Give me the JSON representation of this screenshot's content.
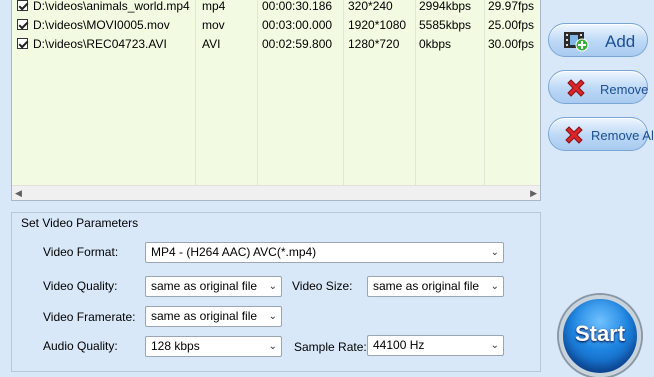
{
  "files": [
    {
      "path": "D:\\videos\\animals_world.mp4",
      "format": "mp4",
      "duration": "00:00:30.186",
      "resolution": "320*240",
      "bitrate": "2994kbps",
      "fps": "29.97fps",
      "checked": true
    },
    {
      "path": "D:\\videos\\MOVI0005.mov",
      "format": "mov",
      "duration": "00:03:00.000",
      "resolution": "1920*1080",
      "bitrate": "5585kbps",
      "fps": "25.00fps",
      "checked": true
    },
    {
      "path": "D:\\videos\\REC04723.AVI",
      "format": "AVI",
      "duration": "00:02:59.800",
      "resolution": "1280*720",
      "bitrate": "0kbps",
      "fps": "30.00fps",
      "checked": true
    }
  ],
  "buttons": {
    "add": "Add",
    "remove": "Remove",
    "remove_all": "Remove All",
    "start": "Start"
  },
  "params": {
    "title": "Set Video Parameters",
    "video_format_label": "Video Format:",
    "video_format_value": "MP4 - (H264 AAC) AVC(*.mp4)",
    "video_quality_label": "Video Quality:",
    "video_quality_value": "same as original file",
    "video_size_label": "Video Size:",
    "video_size_value": "same as original file",
    "video_framerate_label": "Video Framerate:",
    "video_framerate_value": "same as original file",
    "audio_quality_label": "Audio Quality:",
    "audio_quality_value": "128 kbps",
    "sample_rate_label": "Sample Rate:",
    "sample_rate_value": "44100 Hz"
  },
  "icons": {
    "scroll_left": "◀",
    "scroll_right": "▶",
    "dropdown": "⌄"
  },
  "colors": {
    "background": "#d8e8f8",
    "list_background": "#f2fbe2",
    "button_text": "#1d4f91",
    "start_button": "#1e84e0"
  }
}
